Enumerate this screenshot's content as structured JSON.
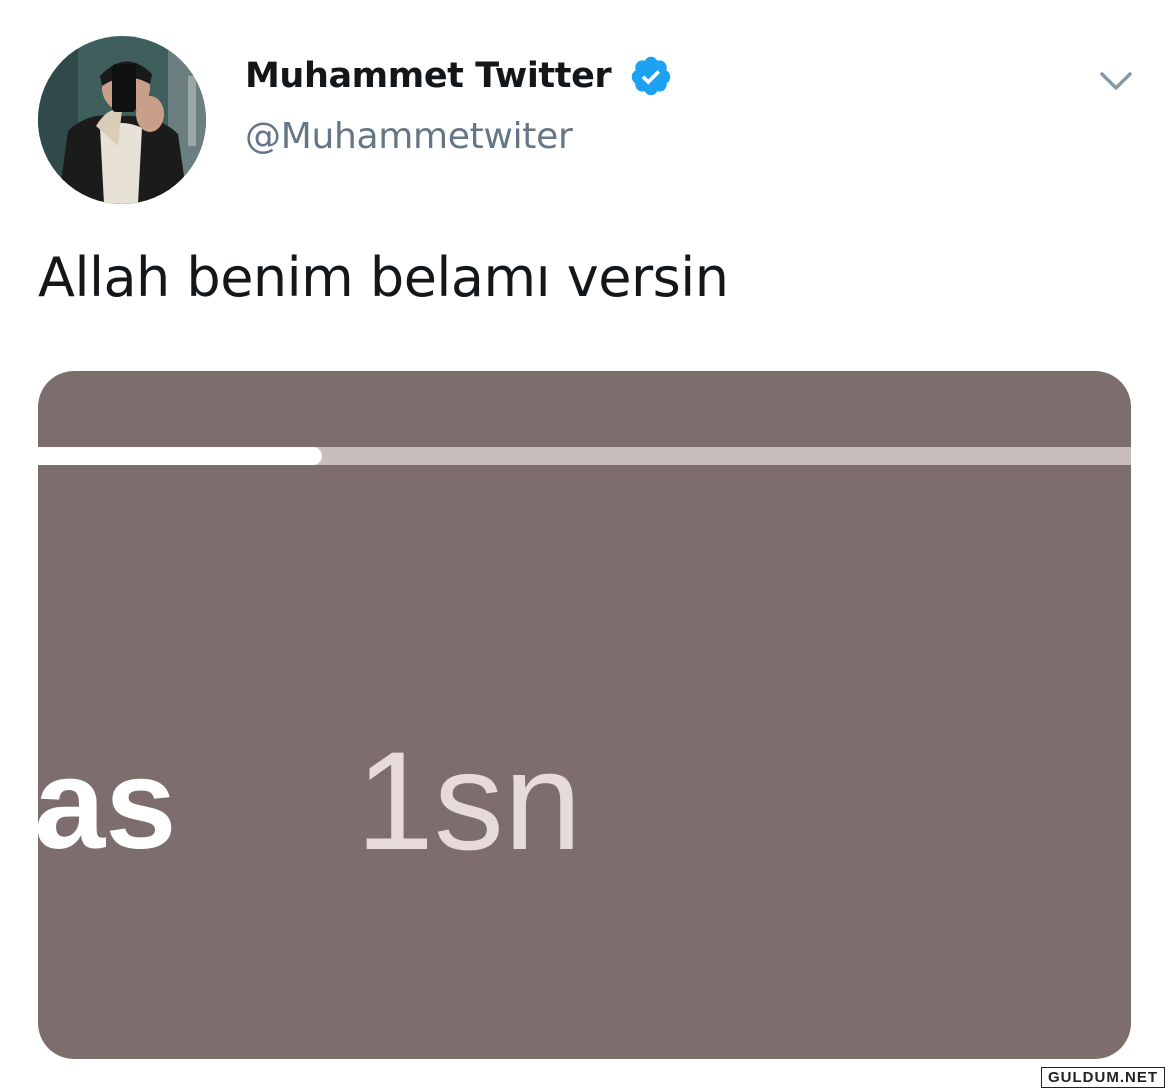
{
  "tweet": {
    "author": {
      "display_name": "Muhammet Twitter",
      "handle": "@Muhammetwiter",
      "verified": true,
      "avatar_icon": "profile-photo"
    },
    "menu_icon": "chevron-down-icon",
    "text": "Allah benim belamı versin",
    "media": {
      "story_username_fragment": "as",
      "story_timestamp": "1sn",
      "progress_fraction": 0.26,
      "background_color": "#7d6d6d"
    }
  },
  "watermark": "GULDUM.NET",
  "colors": {
    "verified_blue": "#1da1f2",
    "text_primary": "#14171a",
    "text_secondary": "#657786"
  }
}
